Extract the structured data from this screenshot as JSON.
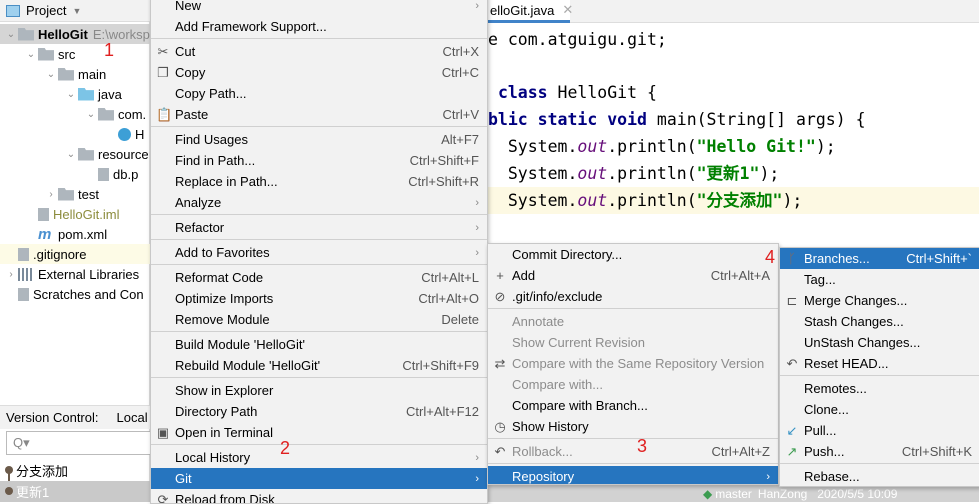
{
  "project_panel": {
    "title": "Project",
    "tree": [
      {
        "label": "HelloGit",
        "extra": "E:\\worksp",
        "depth": 0,
        "icon": "module-folder-icon",
        "expanded": true,
        "bold": true
      },
      {
        "label": "src",
        "depth": 1,
        "icon": "folder-icon",
        "expanded": true
      },
      {
        "label": "main",
        "depth": 2,
        "icon": "folder-icon",
        "expanded": true
      },
      {
        "label": "java",
        "depth": 3,
        "icon": "source-folder-icon",
        "expanded": true
      },
      {
        "label": "com.",
        "depth": 4,
        "icon": "package-icon",
        "expanded": true
      },
      {
        "label": "H",
        "depth": 5,
        "icon": "java-class-icon"
      },
      {
        "label": "resource",
        "depth": 3,
        "icon": "resources-folder-icon",
        "expanded": true
      },
      {
        "label": "db.p",
        "depth": 4,
        "icon": "properties-file-icon"
      },
      {
        "label": "test",
        "depth": 2,
        "icon": "folder-icon",
        "expanded": false
      },
      {
        "label": "HelloGit.iml",
        "depth": 1,
        "icon": "iml-file-icon",
        "color": "#8c8c3c"
      },
      {
        "label": "pom.xml",
        "depth": 1,
        "icon": "maven-icon"
      },
      {
        "label": ".gitignore",
        "depth": 0,
        "icon": "ignored-file-icon",
        "highlight": true
      },
      {
        "label": "External Libraries",
        "depth": 0,
        "icon": "library-icon",
        "expanded": false
      },
      {
        "label": "Scratches and Con",
        "depth": 0,
        "icon": "scratches-icon"
      }
    ]
  },
  "version_control": {
    "title": "Version Control:",
    "tab": "Local",
    "search_placeholder": "Q▾",
    "log": [
      "分支添加",
      "更新1"
    ]
  },
  "editor": {
    "tab": "elloGit.java",
    "lines": [
      [
        {
          "t": "e com.atguigu.git;"
        }
      ],
      [],
      [
        {
          "t": " "
        },
        {
          "t": "class",
          "c": "kw"
        },
        {
          "t": " HelloGit {"
        }
      ],
      [
        {
          "t": "blic static void",
          "c": "kw"
        },
        {
          "t": " main(String[] args) {"
        }
      ],
      [
        {
          "t": "  System."
        },
        {
          "t": "out",
          "c": "fi"
        },
        {
          "t": ".println("
        },
        {
          "t": "\"Hello Git!\"",
          "c": "st"
        },
        {
          "t": ");"
        }
      ],
      [
        {
          "t": "  System."
        },
        {
          "t": "out",
          "c": "fi"
        },
        {
          "t": ".println("
        },
        {
          "t": "\"更新1\"",
          "c": "st"
        },
        {
          "t": ");"
        }
      ],
      [
        {
          "t": "  System."
        },
        {
          "t": "out",
          "c": "fi"
        },
        {
          "t": ".println("
        },
        {
          "t": "\"分支添加\"",
          "c": "st"
        },
        {
          "t": ");"
        }
      ]
    ]
  },
  "context_menu": [
    {
      "label": "New",
      "arrow": true
    },
    {
      "label": "Add Framework Support..."
    },
    {
      "sep": true
    },
    {
      "label": "Cut",
      "sc": "Ctrl+X",
      "icon": "✂",
      "iname": "cut-icon"
    },
    {
      "label": "Copy",
      "sc": "Ctrl+C",
      "icon": "❐",
      "iname": "copy-icon"
    },
    {
      "label": "Copy Path..."
    },
    {
      "label": "Paste",
      "sc": "Ctrl+V",
      "icon": "📋",
      "iname": "paste-icon"
    },
    {
      "sep": true
    },
    {
      "label": "Find Usages",
      "sc": "Alt+F7"
    },
    {
      "label": "Find in Path...",
      "sc": "Ctrl+Shift+F"
    },
    {
      "label": "Replace in Path...",
      "sc": "Ctrl+Shift+R"
    },
    {
      "label": "Analyze",
      "arrow": true
    },
    {
      "sep": true
    },
    {
      "label": "Refactor",
      "arrow": true
    },
    {
      "sep": true
    },
    {
      "label": "Add to Favorites",
      "arrow": true
    },
    {
      "sep": true
    },
    {
      "label": "Reformat Code",
      "sc": "Ctrl+Alt+L"
    },
    {
      "label": "Optimize Imports",
      "sc": "Ctrl+Alt+O"
    },
    {
      "label": "Remove Module",
      "sc": "Delete"
    },
    {
      "sep": true
    },
    {
      "label": "Build Module 'HelloGit'"
    },
    {
      "label": "Rebuild Module 'HelloGit'",
      "sc": "Ctrl+Shift+F9"
    },
    {
      "sep": true
    },
    {
      "label": "Show in Explorer"
    },
    {
      "label": "Directory Path",
      "sc": "Ctrl+Alt+F12"
    },
    {
      "label": "Open in Terminal",
      "icon": "▣",
      "iname": "terminal-icon"
    },
    {
      "sep": true
    },
    {
      "label": "Local History",
      "arrow": true
    },
    {
      "label": "Git",
      "arrow": true,
      "hl": true
    },
    {
      "label": "Reload from Disk",
      "icon": "⟳",
      "iname": "reload-icon"
    }
  ],
  "git_menu": [
    {
      "label": "Commit Directory..."
    },
    {
      "label": "Add",
      "sc": "Ctrl+Alt+A",
      "icon": "+",
      "iname": "add-icon"
    },
    {
      "label": ".git/info/exclude",
      "icon": "⊘",
      "iname": "ignore-file-icon"
    },
    {
      "sep": true
    },
    {
      "label": "Annotate",
      "dis": true
    },
    {
      "label": "Show Current Revision",
      "dis": true
    },
    {
      "label": "Compare with the Same Repository Version",
      "dis": true,
      "icon": "⇄",
      "iname": "compare-icon"
    },
    {
      "label": "Compare with...",
      "dis": true
    },
    {
      "label": "Compare with Branch..."
    },
    {
      "label": "Show History",
      "icon": "◷",
      "iname": "history-icon"
    },
    {
      "sep": true
    },
    {
      "label": "Rollback...",
      "sc": "Ctrl+Alt+Z",
      "dis": true,
      "icon": "↶",
      "iname": "rollback-icon"
    },
    {
      "sep": true
    },
    {
      "label": "Repository",
      "arrow": true,
      "hl": true
    }
  ],
  "repo_menu": [
    {
      "label": "Branches...",
      "sc": "Ctrl+Shift+`",
      "hl": true,
      "icon": "ᚴ",
      "iname": "branch-icon"
    },
    {
      "label": "Tag..."
    },
    {
      "label": "Merge Changes...",
      "icon": "⊏",
      "iname": "merge-icon"
    },
    {
      "label": "Stash Changes..."
    },
    {
      "label": "UnStash Changes..."
    },
    {
      "label": "Reset HEAD...",
      "icon": "↶",
      "iname": "reset-icon"
    },
    {
      "sep": true
    },
    {
      "label": "Remotes..."
    },
    {
      "label": "Clone..."
    },
    {
      "label": "Pull...",
      "icon": "↙",
      "iname": "pull-icon",
      "ic": "#3592c4"
    },
    {
      "label": "Push...",
      "sc": "Ctrl+Shift+K",
      "icon": "↗",
      "iname": "push-icon",
      "ic": "#3c9c50"
    },
    {
      "sep": true
    },
    {
      "label": "Rebase..."
    }
  ],
  "annotations": [
    "1",
    "2",
    "3",
    "4"
  ],
  "status": {
    "branch": "master",
    "author": "HanZong",
    "datetime": "2020/5/5 10:09"
  },
  "colors": {
    "highlight": "#2675bf",
    "annotation": "#e02020",
    "current_line": "#fdf9e3"
  }
}
